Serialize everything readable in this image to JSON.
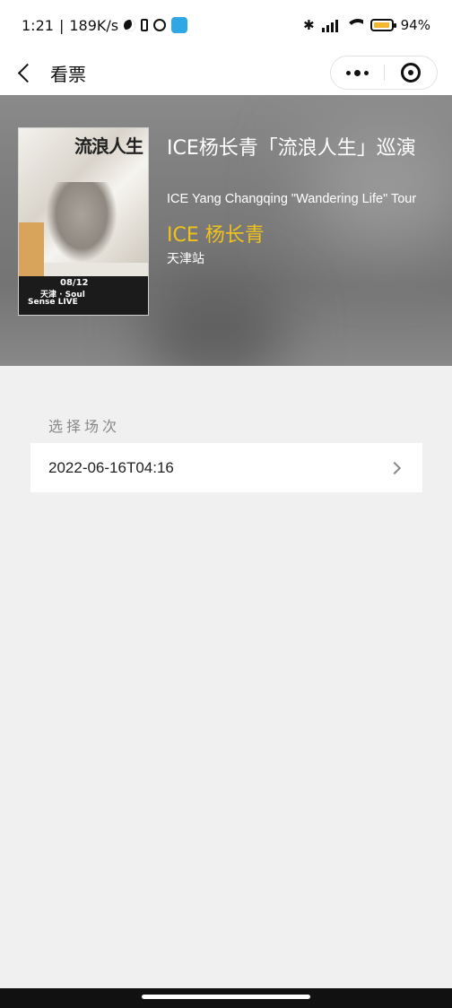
{
  "status_bar": {
    "time": "1:21",
    "network_speed": "189K/s",
    "battery_percent": "94",
    "battery_level": 0.94,
    "icons": [
      "moon-icon",
      "vibrate-icon",
      "alarm-icon",
      "cloud-app-icon",
      "bluetooth-icon",
      "hd-signal-icon",
      "wifi-icon",
      "battery-icon"
    ]
  },
  "nav": {
    "title": "看票"
  },
  "hero": {
    "title": "ICE杨长青「流浪人生」巡演",
    "subtitle": "ICE Yang Changqing \"Wandering Life\" Tour",
    "artist": "ICE 杨长青",
    "city": "天津站",
    "poster": {
      "title": "流浪人生",
      "date": "08/12",
      "line1": "天津 · Soul",
      "line2": "Sense LIVE"
    },
    "accent_color": "#f1c21b"
  },
  "sessions": {
    "label": "选择场次",
    "items": [
      {
        "datetime": "2022-06-16T04:16"
      }
    ]
  }
}
